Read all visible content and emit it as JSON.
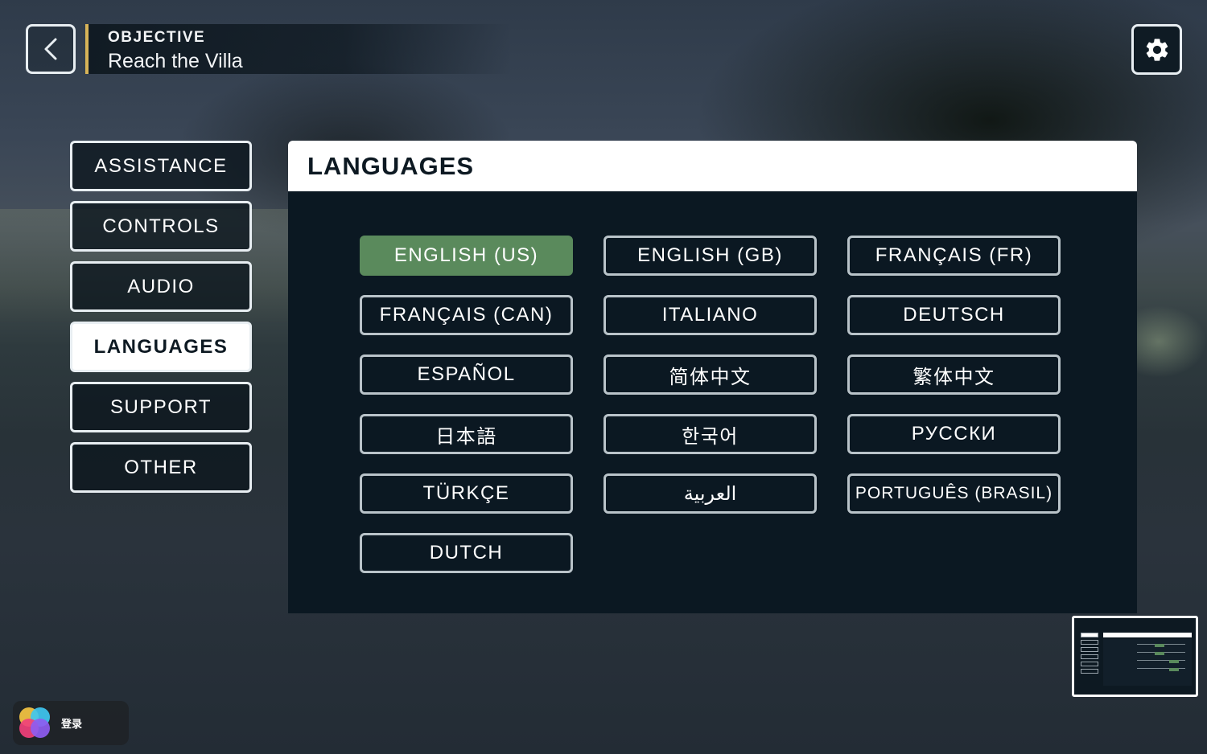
{
  "header": {
    "objective_label": "OBJECTIVE",
    "objective_value": "Reach the Villa"
  },
  "icons": {
    "back": "chevron-left-icon",
    "settings": "gear-icon",
    "login_logo": "game-center-logo-icon"
  },
  "menu": {
    "items": [
      {
        "label": "ASSISTANCE",
        "active": false
      },
      {
        "label": "CONTROLS",
        "active": false
      },
      {
        "label": "AUDIO",
        "active": false
      },
      {
        "label": "LANGUAGES",
        "active": true
      },
      {
        "label": "SUPPORT",
        "active": false
      },
      {
        "label": "OTHER",
        "active": false
      }
    ]
  },
  "panel": {
    "title": "LANGUAGES",
    "languages": [
      {
        "label": "ENGLISH (US)",
        "selected": true
      },
      {
        "label": "ENGLISH (GB)",
        "selected": false
      },
      {
        "label": "FRANÇAIS (FR)",
        "selected": false
      },
      {
        "label": "FRANÇAIS (CAN)",
        "selected": false
      },
      {
        "label": "ITALIANO",
        "selected": false
      },
      {
        "label": "DEUTSCH",
        "selected": false
      },
      {
        "label": "ESPAÑOL",
        "selected": false
      },
      {
        "label": "简体中文",
        "selected": false
      },
      {
        "label": "繁体中文",
        "selected": false
      },
      {
        "label": "日本語",
        "selected": false
      },
      {
        "label": "한국어",
        "selected": false
      },
      {
        "label": "РУССКИ",
        "selected": false
      },
      {
        "label": "TÜRKÇE",
        "selected": false
      },
      {
        "label": "العربية",
        "selected": false
      },
      {
        "label": "PORTUGUÊS (BRASIL)",
        "selected": false
      },
      {
        "label": "DUTCH",
        "selected": false
      }
    ]
  },
  "login": {
    "label": "登录"
  },
  "colors": {
    "selected_language": "#5a8a5c",
    "objective_accent": "#d8b458",
    "panel_background": "#0b1822"
  }
}
